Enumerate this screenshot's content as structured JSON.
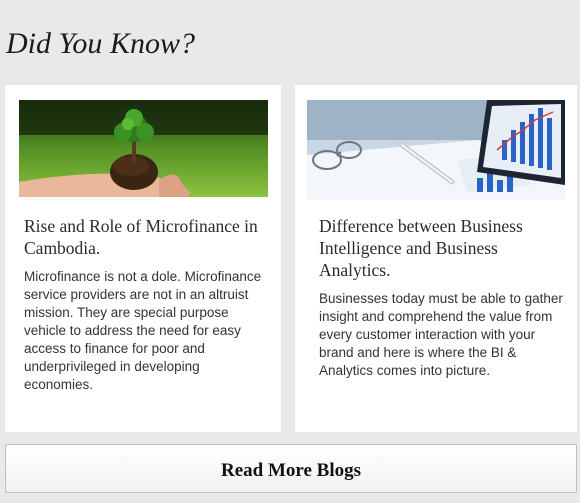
{
  "section": {
    "heading": "Did You Know?"
  },
  "cards": [
    {
      "title": "Rise and Role of Microfinance in Cambodia.",
      "body": "Microfinance is not a dole. Microfinance service providers are not in an altruist mission. They are special purpose vehicle to address the need for easy access to finance for poor and underprivileged in developing economies.",
      "image": "hands-holding-tree-sapling"
    },
    {
      "title": "Difference between Business Intelligence and Business Analytics.",
      "body": "Businesses today must be able to gather insight and comprehend the value from every customer interaction with your brand and here is where the BI & Analytics comes into picture.",
      "image": "business-charts-laptop-pen"
    }
  ],
  "buttons": {
    "read_more": "Read More Blogs"
  },
  "colors": {
    "background": "#e9e9e9",
    "card": "#ffffff",
    "text": "#333333"
  }
}
